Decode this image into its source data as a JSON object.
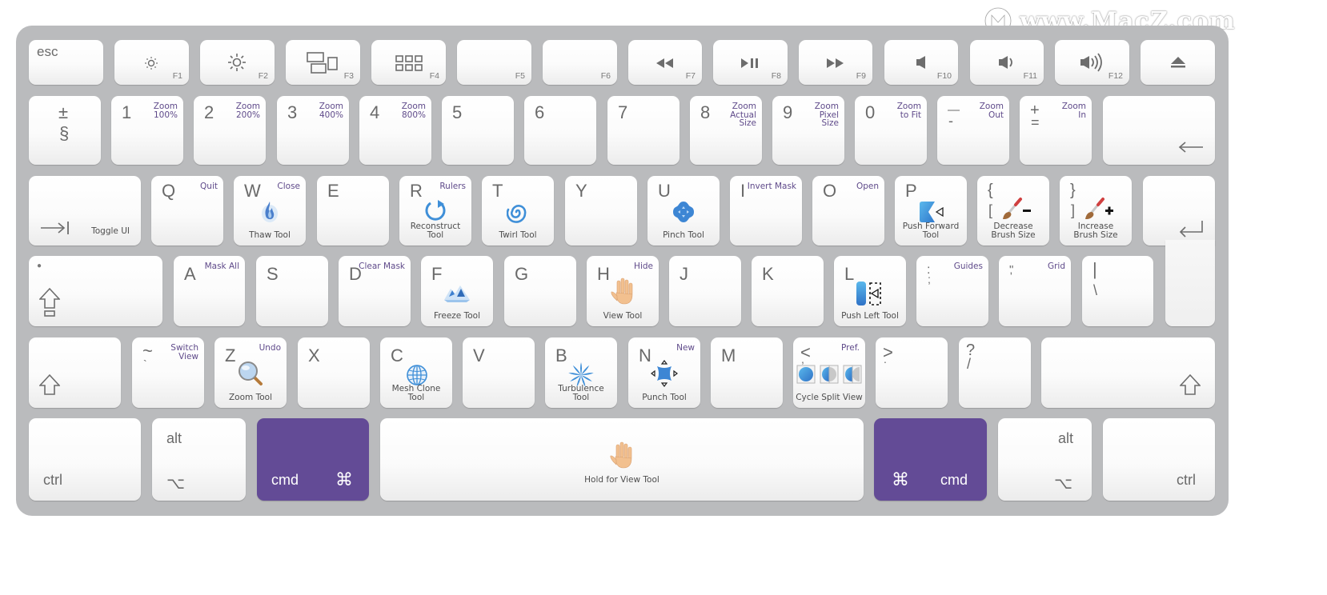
{
  "watermark": "www.MacZ.com",
  "colors": {
    "board": "#babbbd",
    "key": "#fbfbfb",
    "accent_purple": "#634b96",
    "shortcut_text": "#5f4a8a",
    "tool_blue": "#3d8fd6"
  },
  "function_row": {
    "esc": "esc",
    "keys": [
      {
        "fn": "F1",
        "icon": "brightness-down-icon"
      },
      {
        "fn": "F2",
        "icon": "brightness-up-icon"
      },
      {
        "fn": "F3",
        "icon": "mission-control-icon"
      },
      {
        "fn": "F4",
        "icon": "launchpad-icon"
      },
      {
        "fn": "F5",
        "icon": ""
      },
      {
        "fn": "F6",
        "icon": ""
      },
      {
        "fn": "F7",
        "icon": "rewind-icon",
        "glyph": "◀◀"
      },
      {
        "fn": "F8",
        "icon": "play-pause-icon",
        "glyph": "▶❙❙"
      },
      {
        "fn": "F9",
        "icon": "fast-forward-icon",
        "glyph": "▶▶"
      },
      {
        "fn": "F10",
        "icon": "mute-icon"
      },
      {
        "fn": "F11",
        "icon": "volume-down-icon"
      },
      {
        "fn": "F12",
        "icon": "volume-up-icon"
      }
    ],
    "eject": "⏏"
  },
  "number_row": {
    "section": {
      "top": "±",
      "bottom": "§"
    },
    "keys": [
      {
        "main": "1",
        "shortcut": "Zoom\n100%"
      },
      {
        "main": "2",
        "shortcut": "Zoom\n200%"
      },
      {
        "main": "3",
        "shortcut": "Zoom\n400%"
      },
      {
        "main": "4",
        "shortcut": "Zoom\n800%"
      },
      {
        "main": "5",
        "shortcut": ""
      },
      {
        "main": "6",
        "shortcut": ""
      },
      {
        "main": "7",
        "shortcut": ""
      },
      {
        "main": "8",
        "shortcut": "Zoom\nActual\nSize"
      },
      {
        "main": "9",
        "shortcut": "Zoom\nPixel\nSize"
      },
      {
        "main": "0",
        "shortcut": "Zoom\nto Fit"
      },
      {
        "main": "—",
        "sub": "-",
        "shortcut": "Zoom\nOut"
      },
      {
        "main": "+",
        "sub": "=",
        "shortcut": "Zoom\nIn"
      }
    ],
    "backspace": "←"
  },
  "qwerty_row": {
    "tab": {
      "glyph": "→|",
      "tool": "Toggle UI"
    },
    "keys": [
      {
        "main": "Q",
        "shortcut": "Quit",
        "tool": ""
      },
      {
        "main": "W",
        "shortcut": "Close",
        "tool": "Thaw Tool",
        "icon": "thaw-tool-icon"
      },
      {
        "main": "E",
        "shortcut": "",
        "tool": ""
      },
      {
        "main": "R",
        "shortcut": "Rulers",
        "tool": "Reconstruct\nTool",
        "icon": "reconstruct-tool-icon"
      },
      {
        "main": "T",
        "shortcut": "",
        "tool": "Twirl Tool",
        "icon": "twirl-tool-icon"
      },
      {
        "main": "Y",
        "shortcut": "",
        "tool": ""
      },
      {
        "main": "U",
        "shortcut": "",
        "tool": "Pinch Tool",
        "icon": "pinch-tool-icon"
      },
      {
        "main": "I",
        "shortcut": "Invert Mask",
        "tool": ""
      },
      {
        "main": "O",
        "shortcut": "Open",
        "tool": ""
      },
      {
        "main": "P",
        "shortcut": "",
        "tool": "Push Forward\nTool",
        "icon": "push-forward-tool-icon"
      },
      {
        "main": "{",
        "sub": "[",
        "shortcut": "",
        "tool": "Decrease\nBrush Size",
        "icon": "decrease-brush-size-icon"
      },
      {
        "main": "}",
        "sub": "]",
        "shortcut": "",
        "tool": "Increase\nBrush Size",
        "icon": "increase-brush-size-icon"
      }
    ],
    "return": "↵"
  },
  "home_row": {
    "caps": {
      "indicator": "●",
      "glyph": "⇪"
    },
    "keys": [
      {
        "main": "A",
        "shortcut": "Mask All",
        "tool": ""
      },
      {
        "main": "S",
        "shortcut": "",
        "tool": ""
      },
      {
        "main": "D",
        "shortcut": "Clear Mask",
        "tool": ""
      },
      {
        "main": "F",
        "shortcut": "",
        "tool": "Freeze Tool",
        "icon": "freeze-tool-icon"
      },
      {
        "main": "G",
        "shortcut": "",
        "tool": ""
      },
      {
        "main": "H",
        "shortcut": "Hide",
        "tool": "View Tool",
        "icon": "hand-icon"
      },
      {
        "main": "J",
        "shortcut": "",
        "tool": ""
      },
      {
        "main": "K",
        "shortcut": "",
        "tool": ""
      },
      {
        "main": "L",
        "shortcut": "",
        "tool": "Push Left Tool",
        "icon": "push-left-tool-icon"
      },
      {
        "main": ":",
        "sub": ";",
        "shortcut": "Guides",
        "tool": ""
      },
      {
        "main": "\"",
        "sub": "'",
        "shortcut": "Grid",
        "tool": ""
      },
      {
        "main": "|",
        "sub": "\\",
        "shortcut": "",
        "tool": ""
      }
    ]
  },
  "bottom_row": {
    "shift_glyph": "⇧",
    "keys": [
      {
        "main": "~",
        "sub": "`",
        "shortcut": "Switch\nView",
        "tool": ""
      },
      {
        "main": "Z",
        "shortcut": "Undo",
        "tool": "Zoom Tool",
        "icon": "zoom-tool-icon"
      },
      {
        "main": "X",
        "shortcut": "",
        "tool": ""
      },
      {
        "main": "C",
        "shortcut": "",
        "tool": "Mesh Clone\nTool",
        "icon": "mesh-clone-tool-icon"
      },
      {
        "main": "V",
        "shortcut": "",
        "tool": ""
      },
      {
        "main": "B",
        "shortcut": "",
        "tool": "Turbulence\nTool",
        "icon": "turbulence-tool-icon"
      },
      {
        "main": "N",
        "shortcut": "New",
        "tool": "Punch Tool",
        "icon": "punch-tool-icon"
      },
      {
        "main": "M",
        "shortcut": "",
        "tool": ""
      },
      {
        "main": "<",
        "sub": ",",
        "shortcut": "Pref.",
        "tool": "Cycle Split View",
        "icon": "cycle-split-view-icon"
      },
      {
        "main": ">",
        "sub": ".",
        "shortcut": "",
        "tool": ""
      },
      {
        "main": "?",
        "sub": "/",
        "shortcut": "",
        "tool": ""
      }
    ]
  },
  "modifier_row": {
    "ctrl": "ctrl",
    "alt": "alt",
    "option_glyph": "⌥",
    "cmd": "cmd",
    "cmd_glyph": "⌘",
    "space_tool": "Hold for View Tool"
  }
}
